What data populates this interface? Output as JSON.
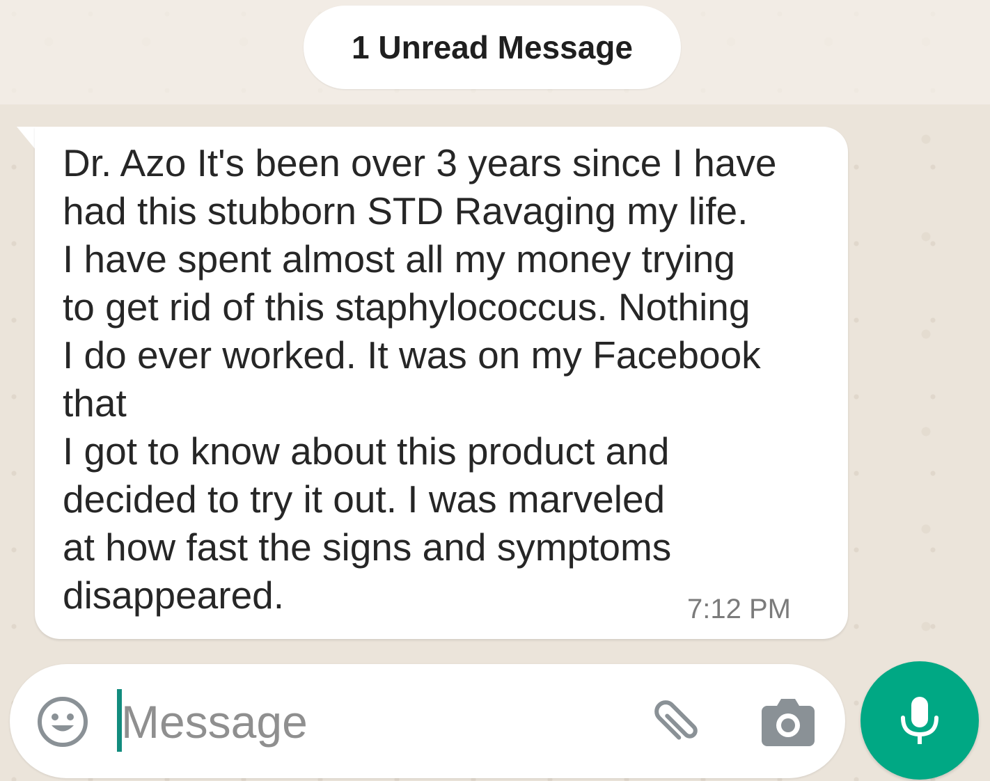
{
  "chat": {
    "unread_banner": "1 Unread Message",
    "message": {
      "lines": [
        "Dr. Azo It's been over 3 years since I have",
        "had this stubborn STD Ravaging my life.",
        "I have spent almost all my money trying",
        "to get rid of this staphylococcus. Nothing",
        "I do ever worked. It was on my Facebook",
        "that",
        "I got to know about this product and",
        "decided to try it out. I was marveled",
        "at how fast the signs and symptoms",
        "disappeared."
      ],
      "time": "7:12 PM"
    }
  },
  "composer": {
    "placeholder": "Message",
    "value": "",
    "icons": {
      "emoji": "emoji-icon",
      "attach": "paperclip-icon",
      "camera": "camera-icon",
      "mic": "microphone-icon"
    }
  },
  "colors": {
    "accent": "#00a884",
    "caret": "#128c7e",
    "bubble": "#ffffff",
    "wallpaper": "#ebe4da"
  }
}
